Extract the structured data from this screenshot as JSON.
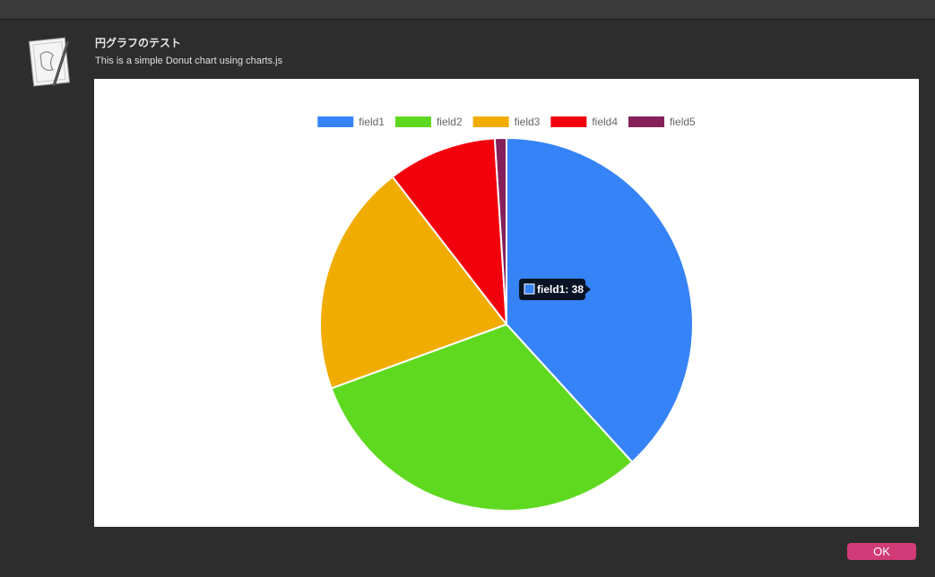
{
  "dialog": {
    "title": "円グラフのテスト",
    "subtitle": "This is a simple Donut chart using charts.js",
    "ok_label": "OK"
  },
  "chart_data": {
    "type": "pie",
    "labels": [
      "field1",
      "field2",
      "field3",
      "field4",
      "field5"
    ],
    "values": [
      38,
      31,
      20,
      9.4,
      1
    ],
    "colors": [
      "#3683f7",
      "#5fd920",
      "#f0ad00",
      "#f3000d",
      "#86205b"
    ],
    "legend_position": "top",
    "tooltip": {
      "label": "field1",
      "value": 38,
      "text": "field1: 38"
    }
  },
  "colors": {
    "ok_button": "#d03b78",
    "background": "#2d2d2d"
  }
}
